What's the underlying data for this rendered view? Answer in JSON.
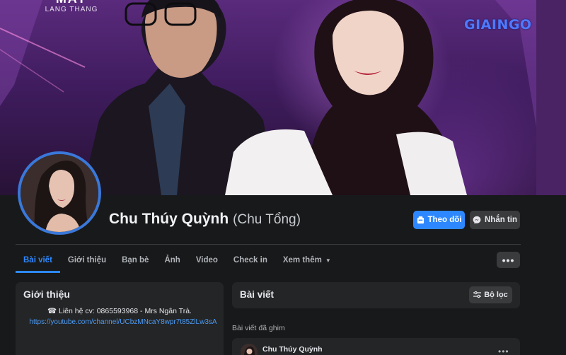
{
  "cover": {
    "brand_title": "MAY",
    "brand_subtitle": "LANG THANG",
    "watermark": "GIAINGO"
  },
  "profile": {
    "name": "Chu Thúy Quỳnh",
    "alt_name": "(Chu Tổng)",
    "follow_label": "Theo dõi",
    "message_label": "Nhắn tin"
  },
  "tabs": [
    {
      "label": "Bài viết",
      "active": true
    },
    {
      "label": "Giới thiệu",
      "active": false
    },
    {
      "label": "Bạn bè",
      "active": false
    },
    {
      "label": "Ảnh",
      "active": false
    },
    {
      "label": "Video",
      "active": false
    },
    {
      "label": "Check in",
      "active": false
    },
    {
      "label": "Xem thêm",
      "active": false
    }
  ],
  "more_label": "•••",
  "intro": {
    "title": "Giới thiệu",
    "contact": "☎ Liên hệ cv: 0865593968 - Mrs Ngân Trà.",
    "link": "https://youtube.com/channel/UCbzMNcaY8wpr7t85ZlLw3sA"
  },
  "posts": {
    "title": "Bài viết",
    "filter_label": "Bộ lọc",
    "pinned_label": "Bài viết đã ghim",
    "pinned_author": "Chu Thúy Quỳnh",
    "post_menu": "•••"
  },
  "colors": {
    "accent": "#2d88ff",
    "background": "#18191a",
    "card": "#242526"
  }
}
